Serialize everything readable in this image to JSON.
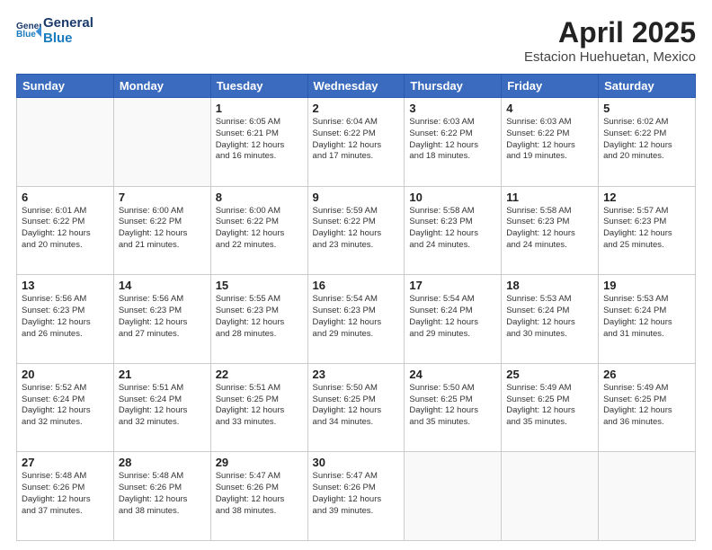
{
  "header": {
    "logo_line1": "General",
    "logo_line2": "Blue",
    "month_title": "April 2025",
    "location": "Estacion Huehuetan, Mexico"
  },
  "days_of_week": [
    "Sunday",
    "Monday",
    "Tuesday",
    "Wednesday",
    "Thursday",
    "Friday",
    "Saturday"
  ],
  "weeks": [
    [
      {
        "day": "",
        "info": ""
      },
      {
        "day": "",
        "info": ""
      },
      {
        "day": "1",
        "info": "Sunrise: 6:05 AM\nSunset: 6:21 PM\nDaylight: 12 hours\nand 16 minutes."
      },
      {
        "day": "2",
        "info": "Sunrise: 6:04 AM\nSunset: 6:22 PM\nDaylight: 12 hours\nand 17 minutes."
      },
      {
        "day": "3",
        "info": "Sunrise: 6:03 AM\nSunset: 6:22 PM\nDaylight: 12 hours\nand 18 minutes."
      },
      {
        "day": "4",
        "info": "Sunrise: 6:03 AM\nSunset: 6:22 PM\nDaylight: 12 hours\nand 19 minutes."
      },
      {
        "day": "5",
        "info": "Sunrise: 6:02 AM\nSunset: 6:22 PM\nDaylight: 12 hours\nand 20 minutes."
      }
    ],
    [
      {
        "day": "6",
        "info": "Sunrise: 6:01 AM\nSunset: 6:22 PM\nDaylight: 12 hours\nand 20 minutes."
      },
      {
        "day": "7",
        "info": "Sunrise: 6:00 AM\nSunset: 6:22 PM\nDaylight: 12 hours\nand 21 minutes."
      },
      {
        "day": "8",
        "info": "Sunrise: 6:00 AM\nSunset: 6:22 PM\nDaylight: 12 hours\nand 22 minutes."
      },
      {
        "day": "9",
        "info": "Sunrise: 5:59 AM\nSunset: 6:22 PM\nDaylight: 12 hours\nand 23 minutes."
      },
      {
        "day": "10",
        "info": "Sunrise: 5:58 AM\nSunset: 6:23 PM\nDaylight: 12 hours\nand 24 minutes."
      },
      {
        "day": "11",
        "info": "Sunrise: 5:58 AM\nSunset: 6:23 PM\nDaylight: 12 hours\nand 24 minutes."
      },
      {
        "day": "12",
        "info": "Sunrise: 5:57 AM\nSunset: 6:23 PM\nDaylight: 12 hours\nand 25 minutes."
      }
    ],
    [
      {
        "day": "13",
        "info": "Sunrise: 5:56 AM\nSunset: 6:23 PM\nDaylight: 12 hours\nand 26 minutes."
      },
      {
        "day": "14",
        "info": "Sunrise: 5:56 AM\nSunset: 6:23 PM\nDaylight: 12 hours\nand 27 minutes."
      },
      {
        "day": "15",
        "info": "Sunrise: 5:55 AM\nSunset: 6:23 PM\nDaylight: 12 hours\nand 28 minutes."
      },
      {
        "day": "16",
        "info": "Sunrise: 5:54 AM\nSunset: 6:23 PM\nDaylight: 12 hours\nand 29 minutes."
      },
      {
        "day": "17",
        "info": "Sunrise: 5:54 AM\nSunset: 6:24 PM\nDaylight: 12 hours\nand 29 minutes."
      },
      {
        "day": "18",
        "info": "Sunrise: 5:53 AM\nSunset: 6:24 PM\nDaylight: 12 hours\nand 30 minutes."
      },
      {
        "day": "19",
        "info": "Sunrise: 5:53 AM\nSunset: 6:24 PM\nDaylight: 12 hours\nand 31 minutes."
      }
    ],
    [
      {
        "day": "20",
        "info": "Sunrise: 5:52 AM\nSunset: 6:24 PM\nDaylight: 12 hours\nand 32 minutes."
      },
      {
        "day": "21",
        "info": "Sunrise: 5:51 AM\nSunset: 6:24 PM\nDaylight: 12 hours\nand 32 minutes."
      },
      {
        "day": "22",
        "info": "Sunrise: 5:51 AM\nSunset: 6:25 PM\nDaylight: 12 hours\nand 33 minutes."
      },
      {
        "day": "23",
        "info": "Sunrise: 5:50 AM\nSunset: 6:25 PM\nDaylight: 12 hours\nand 34 minutes."
      },
      {
        "day": "24",
        "info": "Sunrise: 5:50 AM\nSunset: 6:25 PM\nDaylight: 12 hours\nand 35 minutes."
      },
      {
        "day": "25",
        "info": "Sunrise: 5:49 AM\nSunset: 6:25 PM\nDaylight: 12 hours\nand 35 minutes."
      },
      {
        "day": "26",
        "info": "Sunrise: 5:49 AM\nSunset: 6:25 PM\nDaylight: 12 hours\nand 36 minutes."
      }
    ],
    [
      {
        "day": "27",
        "info": "Sunrise: 5:48 AM\nSunset: 6:26 PM\nDaylight: 12 hours\nand 37 minutes."
      },
      {
        "day": "28",
        "info": "Sunrise: 5:48 AM\nSunset: 6:26 PM\nDaylight: 12 hours\nand 38 minutes."
      },
      {
        "day": "29",
        "info": "Sunrise: 5:47 AM\nSunset: 6:26 PM\nDaylight: 12 hours\nand 38 minutes."
      },
      {
        "day": "30",
        "info": "Sunrise: 5:47 AM\nSunset: 6:26 PM\nDaylight: 12 hours\nand 39 minutes."
      },
      {
        "day": "",
        "info": ""
      },
      {
        "day": "",
        "info": ""
      },
      {
        "day": "",
        "info": ""
      }
    ]
  ]
}
